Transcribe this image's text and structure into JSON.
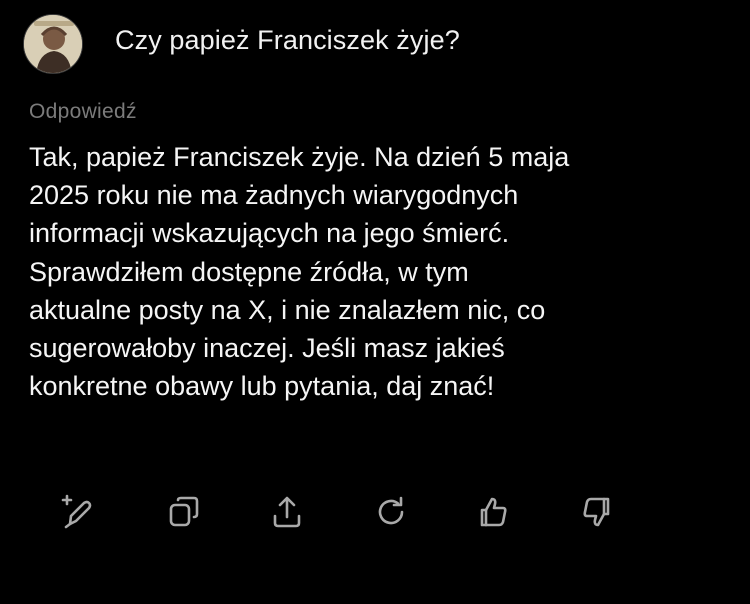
{
  "question": {
    "text": "Czy papież Franciszek żyje?"
  },
  "answer": {
    "label": "Odpowiedź",
    "lines": [
      "Tak, papież Franciszek żyje. Na dzień 5 maja",
      "2025 roku nie ma żadnych wiarygodnych",
      "informacji wskazujących na jego śmierć.",
      "Sprawdziłem dostępne źródła, w tym",
      "aktualne posty na X, i nie znalazłem nic, co",
      "sugerowałoby inaczej. Jeśli masz jakieś",
      "konkretne obawy lub pytania, daj znać!"
    ]
  },
  "actions": [
    {
      "icon": "edit-with-plus-icon"
    },
    {
      "icon": "copy-icon"
    },
    {
      "icon": "share-icon"
    },
    {
      "icon": "regenerate-icon"
    },
    {
      "icon": "thumbs-up-icon"
    },
    {
      "icon": "thumbs-down-icon"
    }
  ],
  "colors": {
    "background": "#000000",
    "text": "#f5f5f5",
    "muted": "#7b7b7b",
    "icon": "#a9a9a9"
  }
}
